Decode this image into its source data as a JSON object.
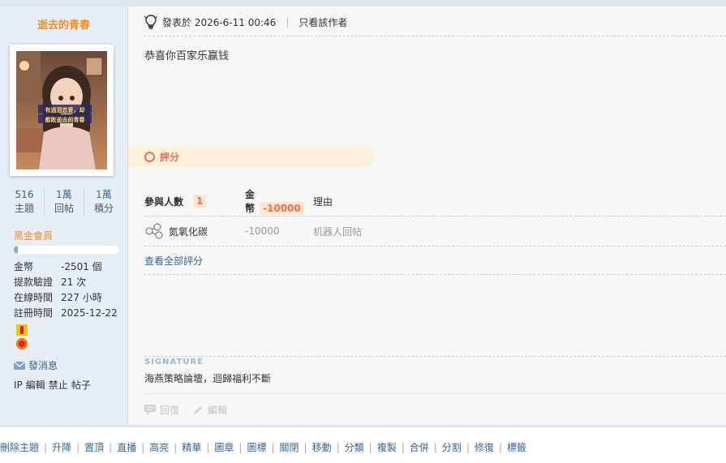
{
  "author": {
    "username": "逝去的青春",
    "avatar_caption_line1": "有過泪恋爱，却",
    "avatar_caption_line2": "都敗逝去的青春",
    "stats": [
      {
        "value": "516",
        "label": "主題"
      },
      {
        "value": "1萬",
        "label": "回帖"
      },
      {
        "value": "1萬",
        "label": "積分"
      }
    ],
    "group": "黑金會員",
    "level_progress": 0.04,
    "info": [
      {
        "key": "金幣",
        "value": "-2501 個"
      },
      {
        "key": "提款驗證",
        "value": "21 次"
      },
      {
        "key": "在線時間",
        "value": "227 小時"
      },
      {
        "key": "註冊時間",
        "value": "2025-12-22"
      }
    ],
    "send_message": "發消息",
    "admin_links": [
      "IP",
      "編輯",
      "禁止",
      "帖子"
    ]
  },
  "post": {
    "posted_label": "發表於 2026-6-11 00:46",
    "only_author": "只看該作者",
    "content": "恭喜你百家乐赢钱"
  },
  "rating": {
    "title": "評分",
    "participants_label": "參與人數",
    "participants": "1",
    "coin_label": "金幣",
    "coin_total": "-10000",
    "reason_label": "理由",
    "rows": [
      {
        "user": "氮氧化碳",
        "value": "-10000",
        "reason": "机器人回帖"
      }
    ],
    "view_all": "查看全部評分"
  },
  "signature": {
    "label": "SIGNATURE",
    "text": "海燕策略論壇，迴歸福利不斷"
  },
  "actions": {
    "reply": "回復",
    "edit": "編輯"
  },
  "mod_actions": [
    "刪除主題",
    "升降",
    "置頂",
    "直播",
    "高亮",
    "精華",
    "圖章",
    "圖標",
    "關閉",
    "移動",
    "分類",
    "複製",
    "合併",
    "分割",
    "修復",
    "標籤"
  ],
  "colors": {
    "accent_orange": "#f28c28",
    "link_blue": "#336699",
    "rating_red": "#f26c4f",
    "sidebar_bg": "#e7eef5"
  }
}
